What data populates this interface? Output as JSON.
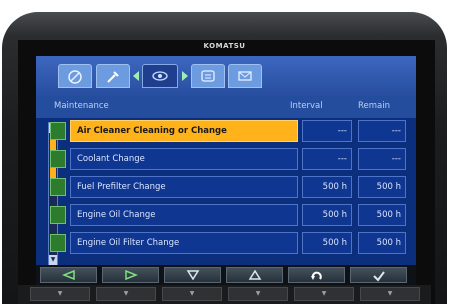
{
  "brand": "KOMATSU",
  "header": {
    "col_item": "Maintenance",
    "col_interval": "Interval",
    "col_remain": "Remain"
  },
  "rows": [
    {
      "name": "Air Cleaner Cleaning or Change",
      "interval": "---",
      "remain": "---",
      "selected": true
    },
    {
      "name": "Coolant Change",
      "interval": "---",
      "remain": "---",
      "selected": false
    },
    {
      "name": "Fuel Prefilter Change",
      "interval": "500 h",
      "remain": "500 h",
      "selected": false
    },
    {
      "name": "Engine Oil Change",
      "interval": "500 h",
      "remain": "500 h",
      "selected": false
    },
    {
      "name": "Engine Oil Filter Change",
      "interval": "500 h",
      "remain": "500 h",
      "selected": false
    }
  ],
  "colors": {
    "accent": "#ffb21a",
    "screen_bg": "#0b2f7c",
    "tab": "#6d9be0"
  }
}
